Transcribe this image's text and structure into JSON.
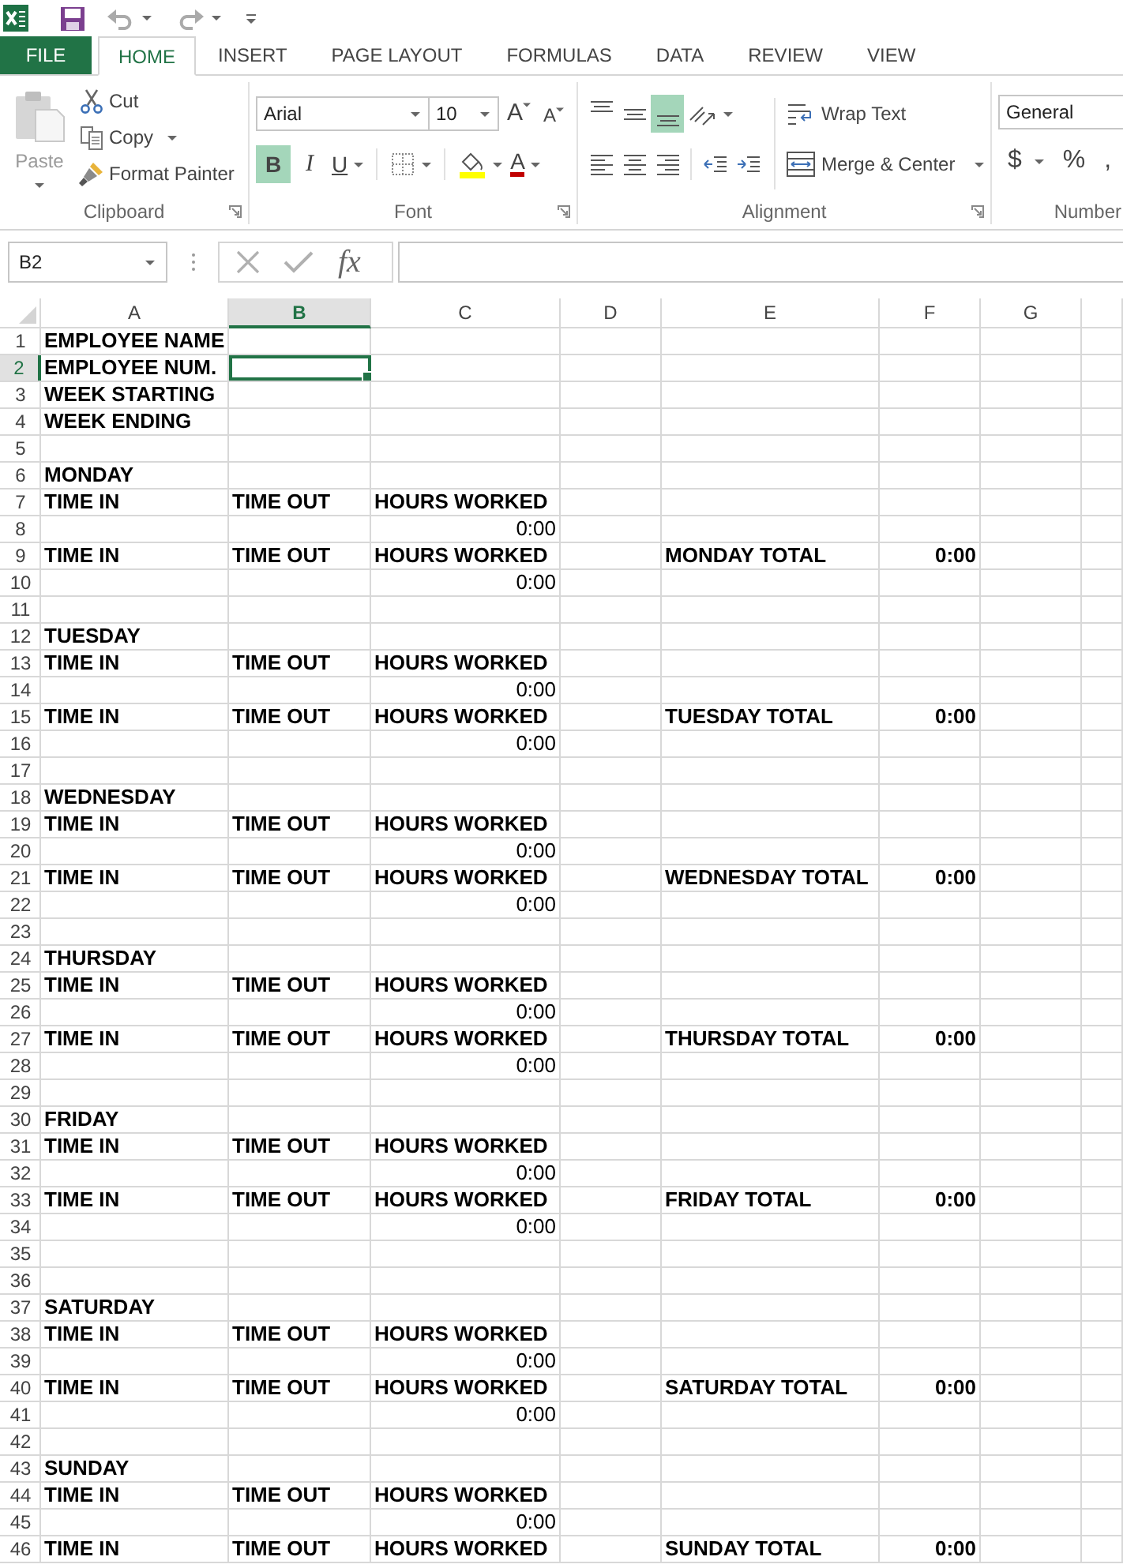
{
  "tabs": [
    {
      "label": "FILE",
      "kind": "file",
      "selected": false
    },
    {
      "label": "HOME",
      "kind": "tab",
      "selected": true
    },
    {
      "label": "INSERT",
      "kind": "tab",
      "selected": false
    },
    {
      "label": "PAGE LAYOUT",
      "kind": "tab",
      "selected": false
    },
    {
      "label": "FORMULAS",
      "kind": "tab",
      "selected": false
    },
    {
      "label": "DATA",
      "kind": "tab",
      "selected": false
    },
    {
      "label": "REVIEW",
      "kind": "tab",
      "selected": false
    },
    {
      "label": "VIEW",
      "kind": "tab",
      "selected": false
    }
  ],
  "ribbon": {
    "clipboard": {
      "title": "Clipboard",
      "paste": {
        "label": "Paste",
        "disabled": true
      },
      "items": [
        {
          "label": "Cut",
          "kind": "cut",
          "dropdown": false
        },
        {
          "label": "Copy",
          "kind": "copy",
          "dropdown": true
        },
        {
          "label": "Format Painter",
          "kind": "painter",
          "dropdown": false
        }
      ]
    },
    "font": {
      "title": "Font",
      "font_name": "Arial",
      "font_size": "10",
      "grow_label": "A",
      "shrink_label": "A",
      "styles": [
        {
          "label": "B",
          "kind": "bold",
          "on": true
        },
        {
          "label": "I",
          "kind": "italic",
          "on": false
        },
        {
          "label": "U",
          "kind": "underline",
          "on": false
        }
      ],
      "font_color_label": "A"
    },
    "alignment": {
      "title": "Alignment",
      "vertical": [
        {
          "kind": "top",
          "on": false
        },
        {
          "kind": "middle",
          "on": false
        },
        {
          "kind": "bottom",
          "on": true
        }
      ],
      "horizontal": [
        {
          "kind": "left",
          "on": false
        },
        {
          "kind": "center",
          "on": false
        },
        {
          "kind": "right",
          "on": false
        }
      ],
      "wrap_text": "Wrap Text",
      "merge_center": "Merge & Center"
    },
    "number": {
      "title": "Number",
      "format": "General",
      "buttons": [
        {
          "label": "$",
          "dropdown": true
        },
        {
          "label": "%",
          "dropdown": false
        },
        {
          "label": ",",
          "dropdown": false
        }
      ]
    }
  },
  "formula_bar": {
    "name_box": "B2",
    "function_label": "fx"
  },
  "sheet": {
    "columns": [
      {
        "label": "A",
        "selected": false
      },
      {
        "label": "B",
        "selected": true
      },
      {
        "label": "C",
        "selected": false
      },
      {
        "label": "D",
        "selected": false
      },
      {
        "label": "E",
        "selected": false
      },
      {
        "label": "F",
        "selected": false
      },
      {
        "label": "G",
        "selected": false
      }
    ],
    "rows": [
      {
        "number": "1",
        "selected": false,
        "cells": {
          "a": {
            "text": "EMPLOYEE NAME",
            "kind": "label"
          }
        }
      },
      {
        "number": "2",
        "selected": true,
        "cells": {
          "a": {
            "text": "EMPLOYEE NUM.",
            "kind": "label"
          }
        }
      },
      {
        "number": "3",
        "selected": false,
        "cells": {
          "a": {
            "text": "WEEK STARTING",
            "kind": "label"
          }
        }
      },
      {
        "number": "4",
        "selected": false,
        "cells": {
          "a": {
            "text": "WEEK ENDING",
            "kind": "label"
          }
        }
      },
      {
        "number": "5",
        "selected": false
      },
      {
        "number": "6",
        "selected": false,
        "cells": {
          "a": {
            "text": "MONDAY",
            "kind": "label"
          }
        }
      },
      {
        "number": "7",
        "selected": false,
        "cells": {
          "a": {
            "text": "TIME IN",
            "kind": "label"
          },
          "b": {
            "text": "TIME OUT",
            "kind": "label"
          },
          "c": {
            "text": "HOURS WORKED",
            "kind": "label"
          }
        }
      },
      {
        "number": "8",
        "selected": false,
        "cells": {
          "c": {
            "text": "0:00",
            "kind": "time"
          }
        }
      },
      {
        "number": "9",
        "selected": false,
        "cells": {
          "a": {
            "text": "TIME IN",
            "kind": "label"
          },
          "b": {
            "text": "TIME OUT",
            "kind": "label"
          },
          "c": {
            "text": "HOURS WORKED",
            "kind": "label"
          },
          "e": {
            "text": "MONDAY TOTAL",
            "kind": "label"
          },
          "f": {
            "text": "0:00",
            "kind": "total"
          }
        }
      },
      {
        "number": "10",
        "selected": false,
        "cells": {
          "c": {
            "text": "0:00",
            "kind": "time"
          }
        }
      },
      {
        "number": "11",
        "selected": false
      },
      {
        "number": "12",
        "selected": false,
        "cells": {
          "a": {
            "text": "TUESDAY",
            "kind": "label"
          }
        }
      },
      {
        "number": "13",
        "selected": false,
        "cells": {
          "a": {
            "text": "TIME IN",
            "kind": "label"
          },
          "b": {
            "text": "TIME OUT",
            "kind": "label"
          },
          "c": {
            "text": "HOURS WORKED",
            "kind": "label"
          }
        }
      },
      {
        "number": "14",
        "selected": false,
        "cells": {
          "c": {
            "text": "0:00",
            "kind": "time"
          }
        }
      },
      {
        "number": "15",
        "selected": false,
        "cells": {
          "a": {
            "text": "TIME IN",
            "kind": "label"
          },
          "b": {
            "text": "TIME OUT",
            "kind": "label"
          },
          "c": {
            "text": "HOURS WORKED",
            "kind": "label"
          },
          "e": {
            "text": "TUESDAY TOTAL",
            "kind": "label"
          },
          "f": {
            "text": "0:00",
            "kind": "total"
          }
        }
      },
      {
        "number": "16",
        "selected": false,
        "cells": {
          "c": {
            "text": "0:00",
            "kind": "time"
          }
        }
      },
      {
        "number": "17",
        "selected": false
      },
      {
        "number": "18",
        "selected": false,
        "cells": {
          "a": {
            "text": "WEDNESDAY",
            "kind": "label"
          }
        }
      },
      {
        "number": "19",
        "selected": false,
        "cells": {
          "a": {
            "text": "TIME IN",
            "kind": "label"
          },
          "b": {
            "text": "TIME OUT",
            "kind": "label"
          },
          "c": {
            "text": "HOURS WORKED",
            "kind": "label"
          }
        }
      },
      {
        "number": "20",
        "selected": false,
        "cells": {
          "c": {
            "text": "0:00",
            "kind": "time"
          }
        }
      },
      {
        "number": "21",
        "selected": false,
        "cells": {
          "a": {
            "text": "TIME IN",
            "kind": "label"
          },
          "b": {
            "text": "TIME OUT",
            "kind": "label"
          },
          "c": {
            "text": "HOURS WORKED",
            "kind": "label"
          },
          "e": {
            "text": "WEDNESDAY TOTAL",
            "kind": "label"
          },
          "f": {
            "text": "0:00",
            "kind": "total"
          }
        }
      },
      {
        "number": "22",
        "selected": false,
        "cells": {
          "c": {
            "text": "0:00",
            "kind": "time"
          }
        }
      },
      {
        "number": "23",
        "selected": false
      },
      {
        "number": "24",
        "selected": false,
        "cells": {
          "a": {
            "text": "THURSDAY",
            "kind": "label"
          }
        }
      },
      {
        "number": "25",
        "selected": false,
        "cells": {
          "a": {
            "text": "TIME IN",
            "kind": "label"
          },
          "b": {
            "text": "TIME OUT",
            "kind": "label"
          },
          "c": {
            "text": "HOURS WORKED",
            "kind": "label"
          }
        }
      },
      {
        "number": "26",
        "selected": false,
        "cells": {
          "c": {
            "text": "0:00",
            "kind": "time"
          }
        }
      },
      {
        "number": "27",
        "selected": false,
        "cells": {
          "a": {
            "text": "TIME IN",
            "kind": "label"
          },
          "b": {
            "text": "TIME OUT",
            "kind": "label"
          },
          "c": {
            "text": "HOURS WORKED",
            "kind": "label"
          },
          "e": {
            "text": "THURSDAY TOTAL",
            "kind": "label"
          },
          "f": {
            "text": "0:00",
            "kind": "total"
          }
        }
      },
      {
        "number": "28",
        "selected": false,
        "cells": {
          "c": {
            "text": "0:00",
            "kind": "time"
          }
        }
      },
      {
        "number": "29",
        "selected": false
      },
      {
        "number": "30",
        "selected": false,
        "cells": {
          "a": {
            "text": "FRIDAY",
            "kind": "label"
          }
        }
      },
      {
        "number": "31",
        "selected": false,
        "cells": {
          "a": {
            "text": "TIME IN",
            "kind": "label"
          },
          "b": {
            "text": "TIME OUT",
            "kind": "label"
          },
          "c": {
            "text": "HOURS WORKED",
            "kind": "label"
          }
        }
      },
      {
        "number": "32",
        "selected": false,
        "cells": {
          "c": {
            "text": "0:00",
            "kind": "time"
          }
        }
      },
      {
        "number": "33",
        "selected": false,
        "cells": {
          "a": {
            "text": "TIME IN",
            "kind": "label"
          },
          "b": {
            "text": "TIME OUT",
            "kind": "label"
          },
          "c": {
            "text": "HOURS WORKED",
            "kind": "label"
          },
          "e": {
            "text": "FRIDAY TOTAL",
            "kind": "label"
          },
          "f": {
            "text": "0:00",
            "kind": "total"
          }
        }
      },
      {
        "number": "34",
        "selected": false,
        "cells": {
          "c": {
            "text": "0:00",
            "kind": "time"
          }
        }
      },
      {
        "number": "35",
        "selected": false
      },
      {
        "number": "36",
        "selected": false
      },
      {
        "number": "37",
        "selected": false,
        "cells": {
          "a": {
            "text": "SATURDAY",
            "kind": "label"
          }
        }
      },
      {
        "number": "38",
        "selected": false,
        "cells": {
          "a": {
            "text": "TIME IN",
            "kind": "label"
          },
          "b": {
            "text": "TIME OUT",
            "kind": "label"
          },
          "c": {
            "text": "HOURS WORKED",
            "kind": "label"
          }
        }
      },
      {
        "number": "39",
        "selected": false,
        "cells": {
          "c": {
            "text": "0:00",
            "kind": "time"
          }
        }
      },
      {
        "number": "40",
        "selected": false,
        "cells": {
          "a": {
            "text": "TIME IN",
            "kind": "label"
          },
          "b": {
            "text": "TIME OUT",
            "kind": "label"
          },
          "c": {
            "text": "HOURS WORKED",
            "kind": "label"
          },
          "e": {
            "text": "SATURDAY TOTAL",
            "kind": "label"
          },
          "f": {
            "text": "0:00",
            "kind": "total"
          }
        }
      },
      {
        "number": "41",
        "selected": false,
        "cells": {
          "c": {
            "text": "0:00",
            "kind": "time"
          }
        }
      },
      {
        "number": "42",
        "selected": false
      },
      {
        "number": "43",
        "selected": false,
        "cells": {
          "a": {
            "text": "SUNDAY",
            "kind": "label"
          }
        }
      },
      {
        "number": "44",
        "selected": false,
        "cells": {
          "a": {
            "text": "TIME IN",
            "kind": "label"
          },
          "b": {
            "text": "TIME OUT",
            "kind": "label"
          },
          "c": {
            "text": "HOURS WORKED",
            "kind": "label"
          }
        }
      },
      {
        "number": "45",
        "selected": false,
        "cells": {
          "c": {
            "text": "0:00",
            "kind": "time"
          }
        }
      },
      {
        "number": "46",
        "selected": false,
        "cells": {
          "a": {
            "text": "TIME IN",
            "kind": "label"
          },
          "b": {
            "text": "TIME OUT",
            "kind": "label"
          },
          "c": {
            "text": "HOURS WORKED",
            "kind": "label"
          },
          "e": {
            "text": "SUNDAY TOTAL",
            "kind": "label"
          },
          "f": {
            "text": "0:00",
            "kind": "total"
          }
        }
      }
    ]
  }
}
